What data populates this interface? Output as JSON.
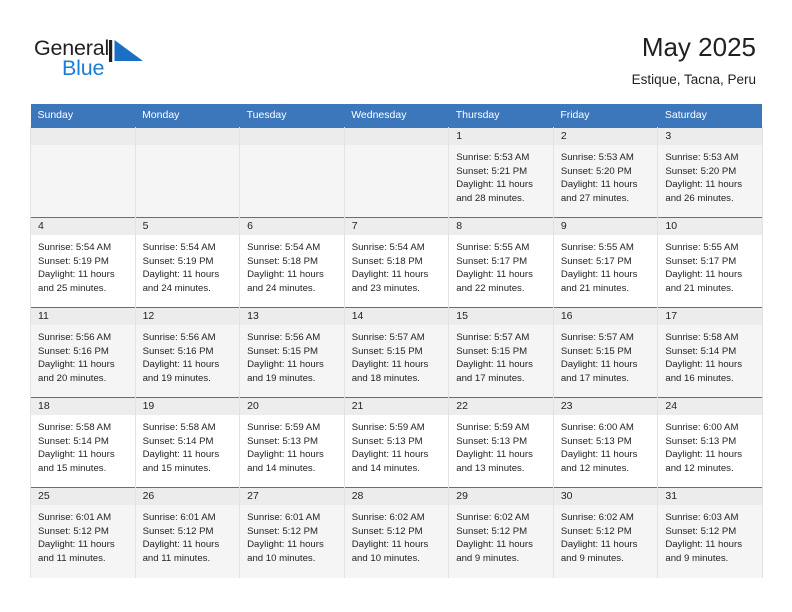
{
  "logo": {
    "text_primary": "General",
    "text_secondary": "Blue",
    "mark": "triangle-mark",
    "color_primary": "#231f20",
    "color_secondary": "#1a7fd4"
  },
  "header": {
    "title": "May 2025",
    "subtitle": "Estique, Tacna, Peru"
  },
  "theme": {
    "header_row_bg": "#3c77bc",
    "header_row_text": "#ffffff",
    "shaded_row_bg": "#f5f5f5",
    "date_strip_bg": "#ececec",
    "cell_border": "#e2e2e2",
    "text": "#231f20"
  },
  "weekdays": [
    "Sunday",
    "Monday",
    "Tuesday",
    "Wednesday",
    "Thursday",
    "Friday",
    "Saturday"
  ],
  "weeks": [
    {
      "shaded": true,
      "days": [
        {
          "date": "",
          "empty": true,
          "sunrise": "",
          "sunset": "",
          "daylight_line1": "",
          "daylight_line2": ""
        },
        {
          "date": "",
          "empty": true,
          "sunrise": "",
          "sunset": "",
          "daylight_line1": "",
          "daylight_line2": ""
        },
        {
          "date": "",
          "empty": true,
          "sunrise": "",
          "sunset": "",
          "daylight_line1": "",
          "daylight_line2": ""
        },
        {
          "date": "",
          "empty": true,
          "sunrise": "",
          "sunset": "",
          "daylight_line1": "",
          "daylight_line2": ""
        },
        {
          "date": "1",
          "empty": false,
          "sunrise": "Sunrise: 5:53 AM",
          "sunset": "Sunset: 5:21 PM",
          "daylight_line1": "Daylight: 11 hours",
          "daylight_line2": "and 28 minutes."
        },
        {
          "date": "2",
          "empty": false,
          "sunrise": "Sunrise: 5:53 AM",
          "sunset": "Sunset: 5:20 PM",
          "daylight_line1": "Daylight: 11 hours",
          "daylight_line2": "and 27 minutes."
        },
        {
          "date": "3",
          "empty": false,
          "sunrise": "Sunrise: 5:53 AM",
          "sunset": "Sunset: 5:20 PM",
          "daylight_line1": "Daylight: 11 hours",
          "daylight_line2": "and 26 minutes."
        }
      ]
    },
    {
      "shaded": false,
      "days": [
        {
          "date": "4",
          "empty": false,
          "sunrise": "Sunrise: 5:54 AM",
          "sunset": "Sunset: 5:19 PM",
          "daylight_line1": "Daylight: 11 hours",
          "daylight_line2": "and 25 minutes."
        },
        {
          "date": "5",
          "empty": false,
          "sunrise": "Sunrise: 5:54 AM",
          "sunset": "Sunset: 5:19 PM",
          "daylight_line1": "Daylight: 11 hours",
          "daylight_line2": "and 24 minutes."
        },
        {
          "date": "6",
          "empty": false,
          "sunrise": "Sunrise: 5:54 AM",
          "sunset": "Sunset: 5:18 PM",
          "daylight_line1": "Daylight: 11 hours",
          "daylight_line2": "and 24 minutes."
        },
        {
          "date": "7",
          "empty": false,
          "sunrise": "Sunrise: 5:54 AM",
          "sunset": "Sunset: 5:18 PM",
          "daylight_line1": "Daylight: 11 hours",
          "daylight_line2": "and 23 minutes."
        },
        {
          "date": "8",
          "empty": false,
          "sunrise": "Sunrise: 5:55 AM",
          "sunset": "Sunset: 5:17 PM",
          "daylight_line1": "Daylight: 11 hours",
          "daylight_line2": "and 22 minutes."
        },
        {
          "date": "9",
          "empty": false,
          "sunrise": "Sunrise: 5:55 AM",
          "sunset": "Sunset: 5:17 PM",
          "daylight_line1": "Daylight: 11 hours",
          "daylight_line2": "and 21 minutes."
        },
        {
          "date": "10",
          "empty": false,
          "sunrise": "Sunrise: 5:55 AM",
          "sunset": "Sunset: 5:17 PM",
          "daylight_line1": "Daylight: 11 hours",
          "daylight_line2": "and 21 minutes."
        }
      ]
    },
    {
      "shaded": true,
      "days": [
        {
          "date": "11",
          "empty": false,
          "sunrise": "Sunrise: 5:56 AM",
          "sunset": "Sunset: 5:16 PM",
          "daylight_line1": "Daylight: 11 hours",
          "daylight_line2": "and 20 minutes."
        },
        {
          "date": "12",
          "empty": false,
          "sunrise": "Sunrise: 5:56 AM",
          "sunset": "Sunset: 5:16 PM",
          "daylight_line1": "Daylight: 11 hours",
          "daylight_line2": "and 19 minutes."
        },
        {
          "date": "13",
          "empty": false,
          "sunrise": "Sunrise: 5:56 AM",
          "sunset": "Sunset: 5:15 PM",
          "daylight_line1": "Daylight: 11 hours",
          "daylight_line2": "and 19 minutes."
        },
        {
          "date": "14",
          "empty": false,
          "sunrise": "Sunrise: 5:57 AM",
          "sunset": "Sunset: 5:15 PM",
          "daylight_line1": "Daylight: 11 hours",
          "daylight_line2": "and 18 minutes."
        },
        {
          "date": "15",
          "empty": false,
          "sunrise": "Sunrise: 5:57 AM",
          "sunset": "Sunset: 5:15 PM",
          "daylight_line1": "Daylight: 11 hours",
          "daylight_line2": "and 17 minutes."
        },
        {
          "date": "16",
          "empty": false,
          "sunrise": "Sunrise: 5:57 AM",
          "sunset": "Sunset: 5:15 PM",
          "daylight_line1": "Daylight: 11 hours",
          "daylight_line2": "and 17 minutes."
        },
        {
          "date": "17",
          "empty": false,
          "sunrise": "Sunrise: 5:58 AM",
          "sunset": "Sunset: 5:14 PM",
          "daylight_line1": "Daylight: 11 hours",
          "daylight_line2": "and 16 minutes."
        }
      ]
    },
    {
      "shaded": false,
      "days": [
        {
          "date": "18",
          "empty": false,
          "sunrise": "Sunrise: 5:58 AM",
          "sunset": "Sunset: 5:14 PM",
          "daylight_line1": "Daylight: 11 hours",
          "daylight_line2": "and 15 minutes."
        },
        {
          "date": "19",
          "empty": false,
          "sunrise": "Sunrise: 5:58 AM",
          "sunset": "Sunset: 5:14 PM",
          "daylight_line1": "Daylight: 11 hours",
          "daylight_line2": "and 15 minutes."
        },
        {
          "date": "20",
          "empty": false,
          "sunrise": "Sunrise: 5:59 AM",
          "sunset": "Sunset: 5:13 PM",
          "daylight_line1": "Daylight: 11 hours",
          "daylight_line2": "and 14 minutes."
        },
        {
          "date": "21",
          "empty": false,
          "sunrise": "Sunrise: 5:59 AM",
          "sunset": "Sunset: 5:13 PM",
          "daylight_line1": "Daylight: 11 hours",
          "daylight_line2": "and 14 minutes."
        },
        {
          "date": "22",
          "empty": false,
          "sunrise": "Sunrise: 5:59 AM",
          "sunset": "Sunset: 5:13 PM",
          "daylight_line1": "Daylight: 11 hours",
          "daylight_line2": "and 13 minutes."
        },
        {
          "date": "23",
          "empty": false,
          "sunrise": "Sunrise: 6:00 AM",
          "sunset": "Sunset: 5:13 PM",
          "daylight_line1": "Daylight: 11 hours",
          "daylight_line2": "and 12 minutes."
        },
        {
          "date": "24",
          "empty": false,
          "sunrise": "Sunrise: 6:00 AM",
          "sunset": "Sunset: 5:13 PM",
          "daylight_line1": "Daylight: 11 hours",
          "daylight_line2": "and 12 minutes."
        }
      ]
    },
    {
      "shaded": true,
      "days": [
        {
          "date": "25",
          "empty": false,
          "sunrise": "Sunrise: 6:01 AM",
          "sunset": "Sunset: 5:12 PM",
          "daylight_line1": "Daylight: 11 hours",
          "daylight_line2": "and 11 minutes."
        },
        {
          "date": "26",
          "empty": false,
          "sunrise": "Sunrise: 6:01 AM",
          "sunset": "Sunset: 5:12 PM",
          "daylight_line1": "Daylight: 11 hours",
          "daylight_line2": "and 11 minutes."
        },
        {
          "date": "27",
          "empty": false,
          "sunrise": "Sunrise: 6:01 AM",
          "sunset": "Sunset: 5:12 PM",
          "daylight_line1": "Daylight: 11 hours",
          "daylight_line2": "and 10 minutes."
        },
        {
          "date": "28",
          "empty": false,
          "sunrise": "Sunrise: 6:02 AM",
          "sunset": "Sunset: 5:12 PM",
          "daylight_line1": "Daylight: 11 hours",
          "daylight_line2": "and 10 minutes."
        },
        {
          "date": "29",
          "empty": false,
          "sunrise": "Sunrise: 6:02 AM",
          "sunset": "Sunset: 5:12 PM",
          "daylight_line1": "Daylight: 11 hours",
          "daylight_line2": "and 9 minutes."
        },
        {
          "date": "30",
          "empty": false,
          "sunrise": "Sunrise: 6:02 AM",
          "sunset": "Sunset: 5:12 PM",
          "daylight_line1": "Daylight: 11 hours",
          "daylight_line2": "and 9 minutes."
        },
        {
          "date": "31",
          "empty": false,
          "sunrise": "Sunrise: 6:03 AM",
          "sunset": "Sunset: 5:12 PM",
          "daylight_line1": "Daylight: 11 hours",
          "daylight_line2": "and 9 minutes."
        }
      ]
    }
  ]
}
